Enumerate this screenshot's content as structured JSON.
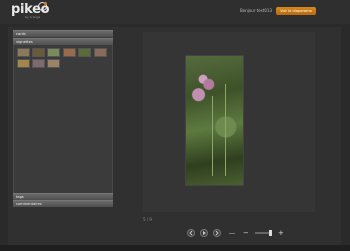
{
  "app": {
    "logo": "pikeo",
    "logo_sub": "by orange",
    "greeting": "Bonjour test013",
    "cta_label": "Voir le diaporama"
  },
  "sidebar": {
    "sections": [
      {
        "label": "cards"
      },
      {
        "label": "vignettes"
      },
      {
        "label": "tags"
      },
      {
        "label": "commentaires"
      }
    ],
    "thumbnails": [
      {
        "color": "#8a7a58"
      },
      {
        "color": "#6a5a3a"
      },
      {
        "color": "#7a8a5a"
      },
      {
        "color": "#9a6a4a"
      },
      {
        "color": "#5a6a3a"
      },
      {
        "color": "#8a6a5a"
      },
      {
        "color": "#a4864a"
      },
      {
        "color": "#7c6a6c"
      },
      {
        "color": "#9b8266"
      }
    ]
  },
  "viewer": {
    "counter": "5 / 9"
  },
  "controls": {
    "prev": "previous-icon",
    "play": "play-icon",
    "next": "next-icon",
    "zoom_out": "−",
    "zoom_in": "+"
  }
}
